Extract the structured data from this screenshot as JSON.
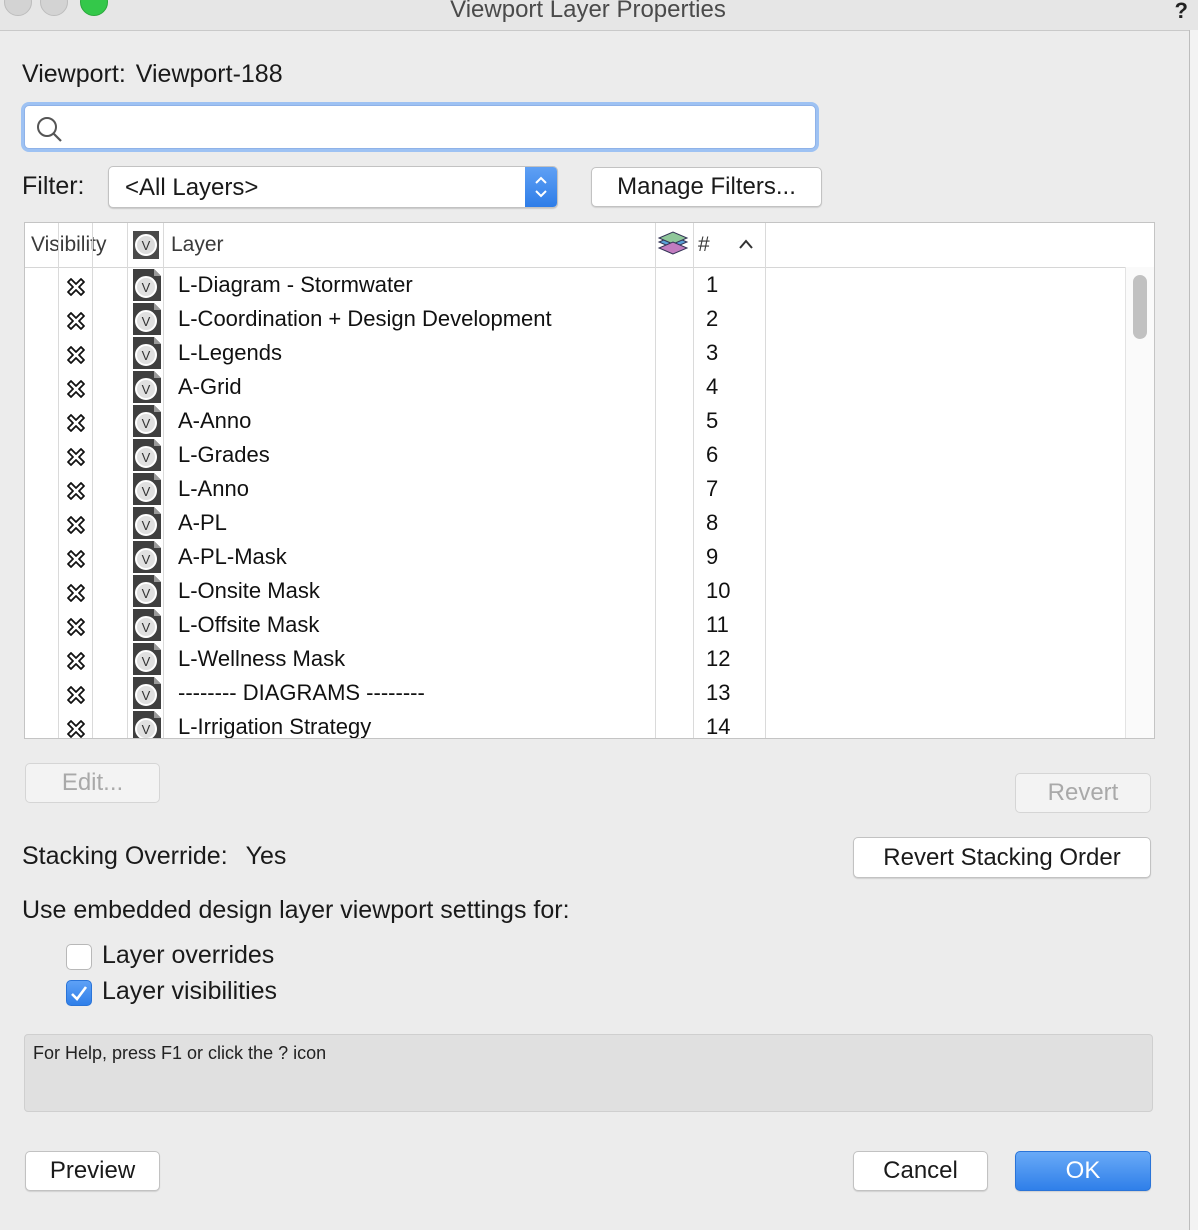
{
  "window": {
    "title": "Viewport Layer Properties",
    "help_glyph": "?"
  },
  "viewport": {
    "label": "Viewport:",
    "name": "Viewport-188"
  },
  "search": {
    "value": "",
    "placeholder": ""
  },
  "filter": {
    "label": "Filter:",
    "selected": "<All Layers>",
    "manage_label": "Manage Filters..."
  },
  "table": {
    "headers": {
      "visibility": "Visibility",
      "layer": "Layer",
      "number": "#"
    },
    "rows": [
      {
        "name": "L-Diagram - Stormwater",
        "num": "1"
      },
      {
        "name": "L-Coordination + Design Development",
        "num": "2"
      },
      {
        "name": "L-Legends",
        "num": "3"
      },
      {
        "name": "A-Grid",
        "num": "4"
      },
      {
        "name": "A-Anno",
        "num": "5"
      },
      {
        "name": "L-Grades",
        "num": "6"
      },
      {
        "name": "L-Anno",
        "num": "7"
      },
      {
        "name": "A-PL",
        "num": "8"
      },
      {
        "name": "A-PL-Mask",
        "num": "9"
      },
      {
        "name": "L-Onsite Mask",
        "num": "10"
      },
      {
        "name": "L-Offsite Mask",
        "num": "11"
      },
      {
        "name": "L-Wellness Mask",
        "num": "12"
      },
      {
        "name": "-------- DIAGRAMS --------",
        "num": "13"
      },
      {
        "name": "L-Irrigation Strategy",
        "num": "14"
      }
    ]
  },
  "buttons": {
    "edit": "Edit...",
    "revert": "Revert",
    "revert_stacking": "Revert Stacking Order",
    "preview": "Preview",
    "cancel": "Cancel",
    "ok": "OK"
  },
  "stacking": {
    "label": "Stacking Override:",
    "value": "Yes"
  },
  "embedded": {
    "label": "Use embedded design layer viewport settings for:",
    "layer_overrides": {
      "label": "Layer overrides",
      "checked": false
    },
    "layer_visibilities": {
      "label": "Layer visibilities",
      "checked": true
    }
  },
  "help_text": "For Help, press F1 or click the ? icon",
  "colors": {
    "accent": "#2f7fe9",
    "focus_ring": "#9ec2f3"
  }
}
